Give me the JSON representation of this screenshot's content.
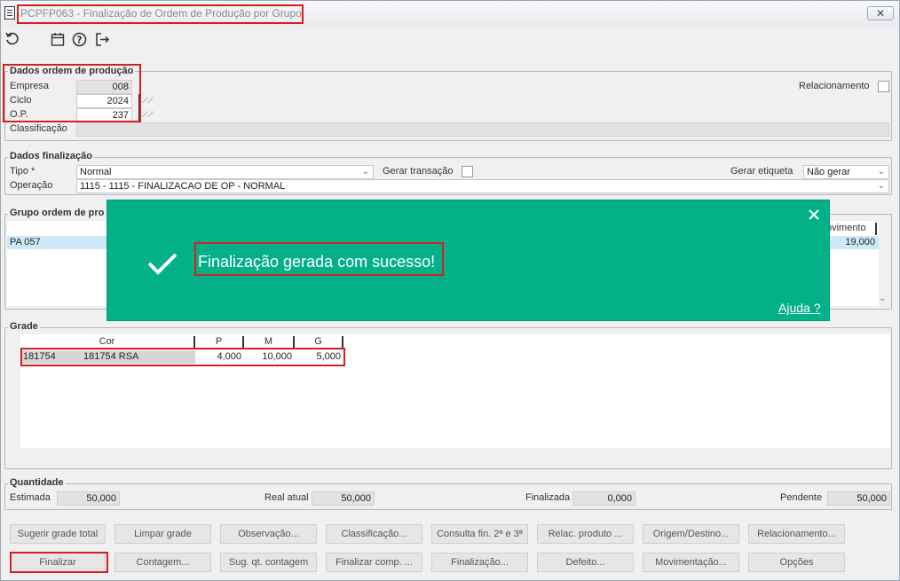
{
  "window": {
    "title": "PCPFP063 - Finalização de Ordem de Produção por Grupo",
    "close_label": "✕"
  },
  "toolbar": {
    "icons": [
      "refresh-icon",
      "calendar-icon",
      "help-icon",
      "exit-icon"
    ]
  },
  "dados_ordem": {
    "title": "Dados ordem de produção",
    "empresa_label": "Empresa",
    "empresa_value": "008",
    "ciclo_label": "Ciclo",
    "ciclo_value": "2024",
    "op_label": "O.P.",
    "op_value": "237",
    "classificacao_label": "Classificação",
    "classificacao_value": "",
    "relacionamento_label": "Relacionamento"
  },
  "dados_finalizacao": {
    "title": "Dados finalização",
    "tipo_label": "Tipo *",
    "tipo_value": "Normal",
    "operacao_label": "Operação",
    "operacao_value": "1115 - 1115 - FINALIZACAO DE OP - NORMAL",
    "gerar_transacao_label": "Gerar transação",
    "gerar_etiqueta_label": "Gerar etiqueta",
    "gerar_etiqueta_value": "Não gerar"
  },
  "grupo_ordem": {
    "title": "Grupo ordem de pro",
    "col_movimento": "ovimento",
    "row_name": "PA 057",
    "row_movimento": "19,000"
  },
  "toast": {
    "message": "Finalização gerada com sucesso!",
    "help_link": "Ajuda ?",
    "close_label": "✕",
    "check_label": "✓"
  },
  "grade": {
    "title": "Grade",
    "headers": [
      "Cor",
      "P",
      "M",
      "G"
    ],
    "row": {
      "code": "181754",
      "cor": "181754 RSA",
      "p": "4,000",
      "m": "10,000",
      "g": "5,000"
    }
  },
  "quantidade": {
    "title": "Quantidade",
    "estimada_label": "Estimada",
    "estimada_value": "50,000",
    "real_label": "Real atual",
    "real_value": "50,000",
    "finalizada_label": "Finalizada",
    "finalizada_value": "0,000",
    "pendente_label": "Pendente",
    "pendente_value": "50,000"
  },
  "buttons_row1": [
    "Sugerir grade total",
    "Limpar grade",
    "Observação...",
    "Classificação...",
    "Consulta fin. 2ª e 3ª",
    "Relac. produto ...",
    "Origem/Destino...",
    "Relacionamento..."
  ],
  "buttons_row2": [
    "Finalizar",
    "Contagem...",
    "Sug. qt. contagem",
    "Finalizar comp. ...",
    "Finalização...",
    "Defeito...",
    "Movimentação...",
    "Opções"
  ]
}
